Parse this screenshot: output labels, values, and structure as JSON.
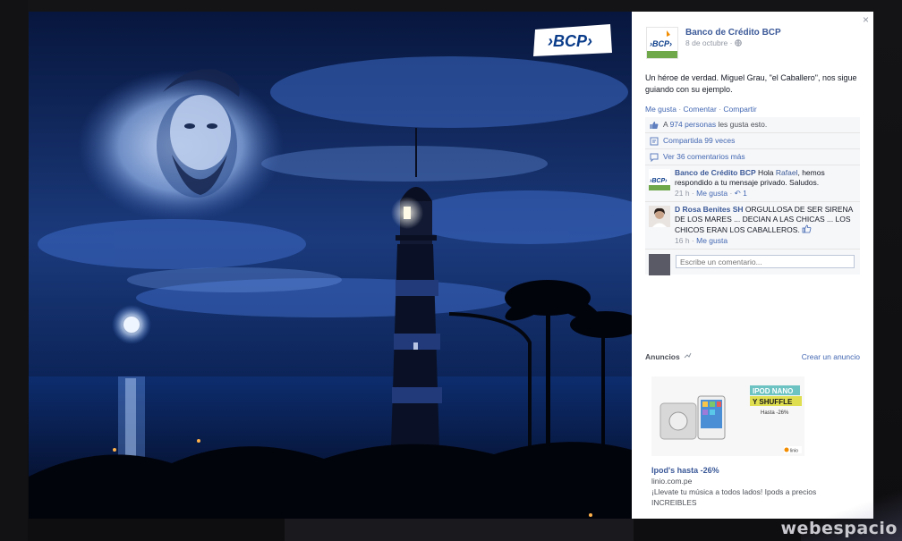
{
  "photo": {
    "brand_logo_text": "›BCP›",
    "colors": {
      "sky_top": "#0b1d4a",
      "sky_mid": "#1c3f86",
      "sea": "#0b2e6a",
      "glow": "#8ab8ff",
      "logo_bg": "#ffffff",
      "logo_text": "#0a3c8a",
      "logo_accent": "#f28c00"
    }
  },
  "panel": {
    "close_icon": "×",
    "page_name": "Banco de Crédito BCP",
    "logo_text": "›BCP›",
    "date": "8 de octubre ·",
    "globe_icon": "globe-icon",
    "post_text": "Un héroe de verdad. Miguel Grau, \"el Caballero\", nos sigue guiando con su ejemplo.",
    "actions": {
      "like": "Me gusta",
      "comment": "Comentar",
      "share": "Compartir",
      "sep": " · "
    },
    "likes": {
      "prefix": "A ",
      "count": "974 personas",
      "suffix": " les gusta esto."
    },
    "shares": "Compartida 99 veces",
    "more_comments": "Ver 36 comentarios más",
    "comments": [
      {
        "author": "Banco de Crédito BCP",
        "text_before": " Hola ",
        "mention": "Rafael",
        "text_after": ", hemos respondido a tu mensaje privado. Saludos.",
        "time": "21 h",
        "like": "Me gusta",
        "replies": "1"
      },
      {
        "author": "D Rosa Benites SH",
        "text": " ORGULLOSA DE SER SIRENA DE LOS MARES ... DECIAN A LAS CHICAS ... LOS CHICOS ERAN LOS CABALLEROS.",
        "time": "16 h",
        "like": "Me gusta"
      }
    ],
    "comment_placeholder": "Escribe un comentario...",
    "ads": {
      "title": "Anuncios",
      "create": "Crear un anuncio",
      "image_headline_1": "IPOD NANO",
      "image_headline_2": "Y SHUFFLE",
      "image_sub": "Hasta -26%",
      "image_brand": "linio",
      "ad_title": "Ipod's hasta -26%",
      "ad_domain": "linio.com.pe",
      "ad_desc": "¡Llevate tu música a todos lados! Ipods a precios INCREIBLES"
    }
  },
  "watermark": "webespacio"
}
